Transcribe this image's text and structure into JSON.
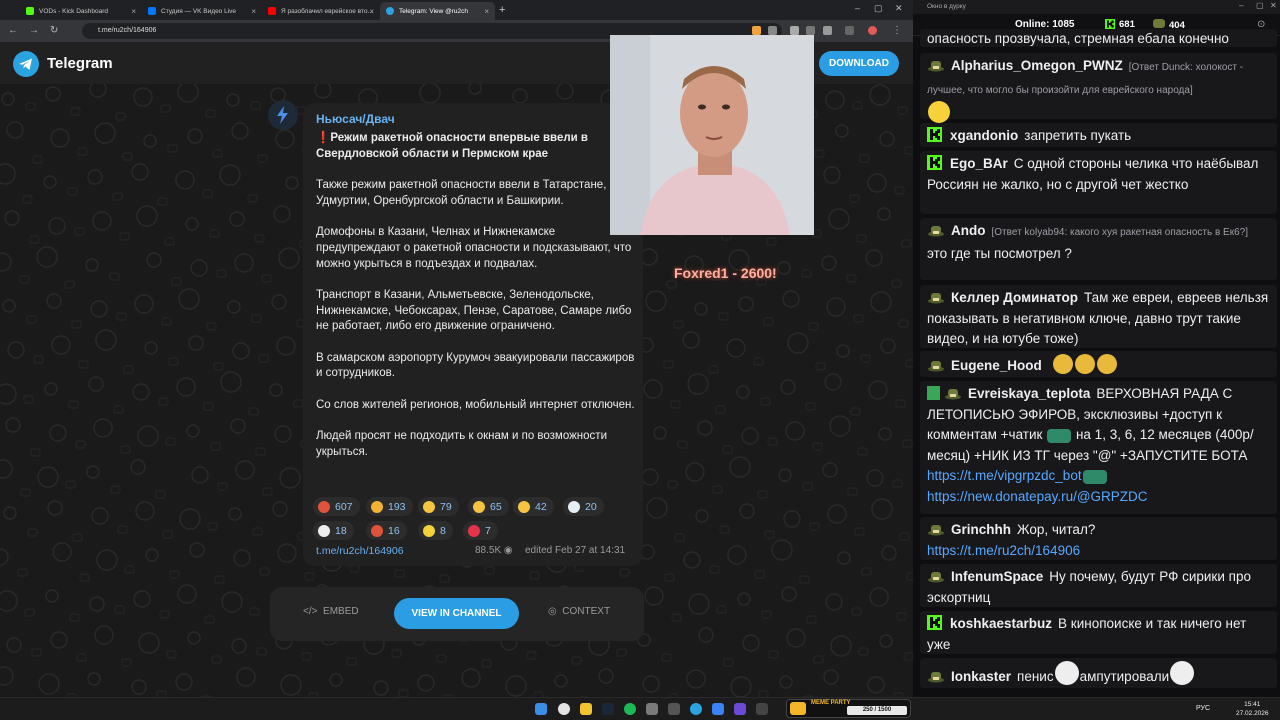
{
  "browser": {
    "tabs": [
      {
        "title": "VODs - Kick Dashboard",
        "color": "#53fc18"
      },
      {
        "title": "Студия — VK Видео Live",
        "color": "#0077ff"
      },
      {
        "title": "Я разоблачил еврейское вто...",
        "color": "#ff0000"
      },
      {
        "title": "Telegram: View @ru2ch",
        "color": "#2aa3e0"
      }
    ],
    "url": "t.me/ru2ch/164906"
  },
  "telegram": {
    "brand": "Telegram",
    "download_label": "DOWNLOAD",
    "post": {
      "channel": "Ньюсач/Двач",
      "headline": "❗️Режим ракетной опасности впервые ввели в Свердловской области и Пермском крае",
      "paragraphs": [
        "Также режим ракетной опасности ввели в Татарстане, Удмуртии, Оренбургской области и Башкирии.",
        "Домофоны в Казани, Челнах и Нижнекамске предупреждают о ракетной опасности и подсказывают, что можно укрыться в подъездах и подвалах.",
        "Транспорт в Казани, Альметьевске, Зеленодольске, Нижнекамске, Чебоксарах, Пензе, Саратове, Самаре либо не работает, либо его движение ограничено.",
        "В самарском аэропорту Курумоч эвакуировали пассажиров и сотрудников.",
        "Со слов жителей регионов, мобильный интернет отключен.",
        "Людей просят не подходить к окнам и по возможности укрыться."
      ],
      "reactions": [
        {
          "emoji": "angry-face",
          "count": "607",
          "color": "#e0533a"
        },
        {
          "emoji": "party-popper",
          "count": "193",
          "color": "#f2b233"
        },
        {
          "emoji": "neutral-face",
          "count": "79",
          "color": "#f5c542"
        },
        {
          "emoji": "nerd-face",
          "count": "65",
          "color": "#f5c542"
        },
        {
          "emoji": "sweat-smile",
          "count": "42",
          "color": "#f5c542"
        },
        {
          "emoji": "dove",
          "count": "20",
          "color": "#e8eef5"
        },
        {
          "emoji": "ghost",
          "count": "18",
          "color": "#eeeeee"
        },
        {
          "emoji": "angry-red",
          "count": "16",
          "color": "#e0533a"
        },
        {
          "emoji": "banana",
          "count": "8",
          "color": "#f3d23a"
        },
        {
          "emoji": "heart-fire",
          "count": "7",
          "color": "#e6334a"
        }
      ],
      "link": "t.me/ru2ch/164906",
      "views": "88.5K",
      "edited": "edited  Feb 27 at 14:31"
    },
    "actions": {
      "embed": "EMBED",
      "view_in_channel": "VIEW IN CHANNEL",
      "context": "CONTEXT"
    }
  },
  "stream_overlay": {
    "text": "Foxred1 - 2600!"
  },
  "chat": {
    "window_title": "Окно в дурку",
    "online_label": "Online:",
    "online_count": "1085",
    "k_count": "681",
    "h_count": "404",
    "top_fragment": "опасность прозвучала, стремная ебала конечно",
    "messages": [
      {
        "user": "Alpharius_Omegon_PWNZ",
        "color": "#4fc0e8",
        "badge": "h",
        "reply": "[Ответ Dunck: холокост - лучшее, что могло бы произойти для еврейского народа]",
        "text": ""
      },
      {
        "user": "xgandonio",
        "color": "#53fc18",
        "badge": "k",
        "text": "запретить пукать"
      },
      {
        "user": "Ego_BAr",
        "color": "#53fc18",
        "badge": "k",
        "text": "С одной стороны челика что наёбывал Россиян не жалко, но с другой чет жестко"
      },
      {
        "user": "Ando",
        "color": "#ff6f6f",
        "badge": "h",
        "reply": "[Ответ kolyab94: какого хуя ракетная опасность в Ек6?]",
        "text": "это где ты посмотрел ?"
      },
      {
        "user": "Келлер Доминатор",
        "color": "#ff9933",
        "badge": "h",
        "text": "Там же евреи, евреев нельзя показывать в негативном ключе, давно трут такие видео, и на ютубе тоже)"
      },
      {
        "user": "Eugene_Hood",
        "color": "#4fc0e8",
        "badge": "h",
        "text": ""
      },
      {
        "user": "Evreiskaya_teplota",
        "color": "#b58cff",
        "badge": "h",
        "text": "ВЕРХОВНАЯ РАДА С ЛЕТОПИСЬЮ ЭФИРОВ, эксклюзивы +доступ к комментам +чатик",
        "text2": "на 1, 3, 6, 12 месяцев (400р/месяц) +НИК ИЗ ТГ через \"@\" +ЗАПУСТИТЕ БОТА",
        "link1": "https://t.me/vipgrpzdc_bot",
        "link2": "https://new.donatepay.ru/@GRPZDC"
      },
      {
        "user": "Grinchhh",
        "color": "#3ad1a3",
        "badge": "h",
        "text": "Жор, читал?",
        "link1": "https://t.me/ru2ch/164906"
      },
      {
        "user": "InfenumSpace",
        "color": "#4fc0e8",
        "badge": "h",
        "text": "Ну почему, будут РФ сирики про эскортниц"
      },
      {
        "user": "koshkaestarbuz",
        "color": "#53fc18",
        "badge": "k",
        "text": "В кинопоиске и так ничего нет уже"
      },
      {
        "user": "Ionkaster",
        "color": "#ff6f6f",
        "badge": "h",
        "text": "пенис",
        "text2": "ампутировали"
      }
    ]
  },
  "taskbar": {
    "lang": "РУС",
    "time": "15:41",
    "date": "27.02.2026",
    "meme_party_label": "MEME PARTY",
    "meme_party_score": "250 / 1500"
  }
}
